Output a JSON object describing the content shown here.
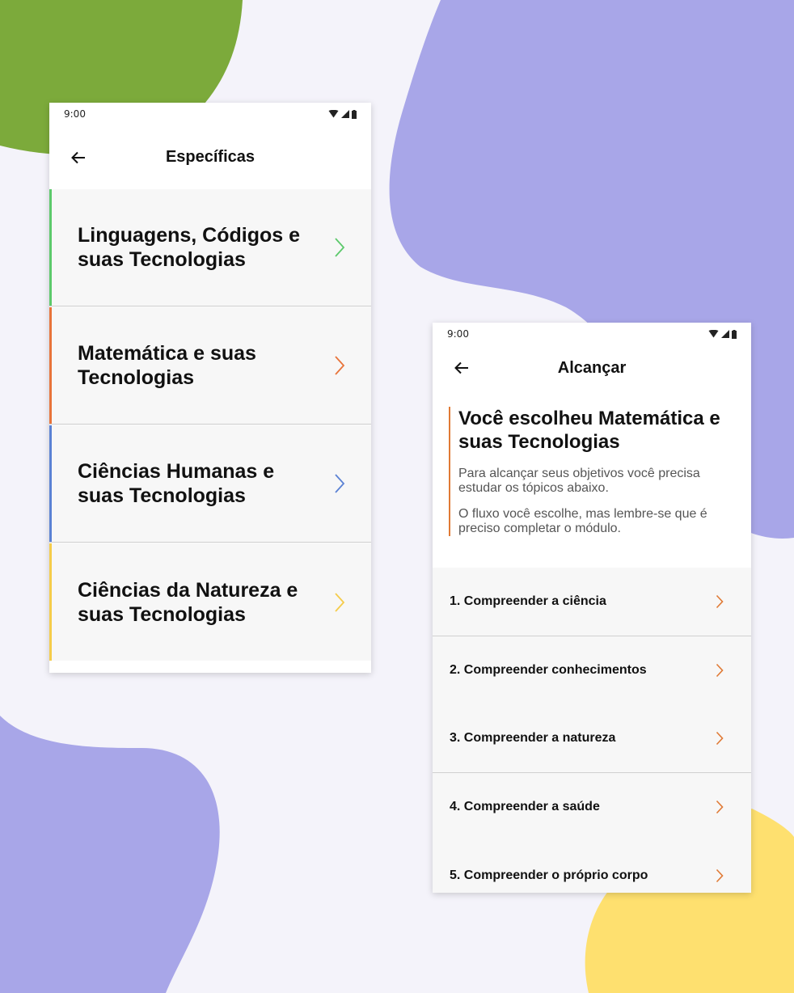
{
  "colors": {
    "background": "#f4f3fa",
    "green": "#7caa3b",
    "purple": "#a8a6e8",
    "yellow": "#fee06f",
    "orange": "#e07a35"
  },
  "screen1": {
    "status_time": "9:00",
    "title": "Específicas",
    "items": [
      {
        "label": "Linguagens, Códigos e suas Tecnologias",
        "color": "#5cc96b"
      },
      {
        "label": "Matemática e suas Tecnologias",
        "color": "#e8743a"
      },
      {
        "label": "Ciências Humanas e suas Tecnologias",
        "color": "#5b82d4"
      },
      {
        "label": "Ciências da Natureza e suas Tecnologias",
        "color": "#f5cc4a"
      }
    ]
  },
  "screen2": {
    "status_time": "9:00",
    "title": "Alcançar",
    "heading": "Você escolheu Matemática e suas Tecnologias",
    "paragraph1": "Para alcançar seus objetivos você precisa estudar os tópicos abaixo.",
    "paragraph2": "O fluxo você escolhe, mas lembre-se que é preciso completar o módulo.",
    "topics": [
      "1. Compreender a ciência",
      "2. Compreender conhecimentos",
      "3. Compreender a natureza",
      "4. Compreender a saúde",
      "5. Compreender o próprio corpo"
    ]
  }
}
